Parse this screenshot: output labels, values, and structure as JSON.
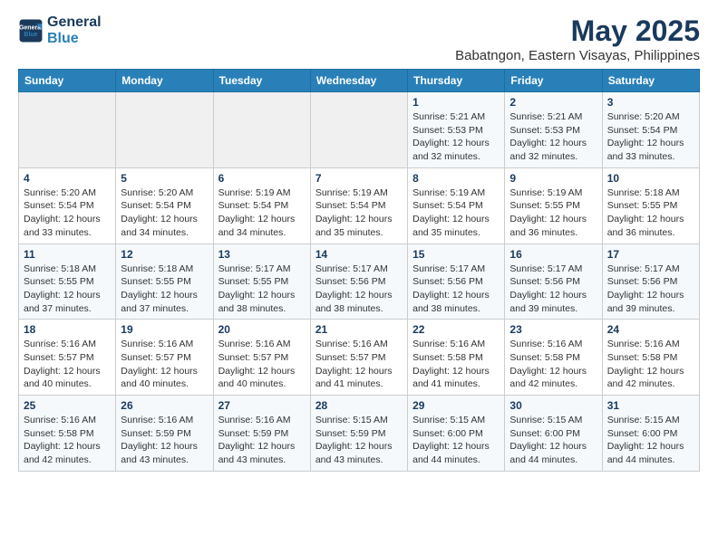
{
  "logo": {
    "line1": "General",
    "line2": "Blue"
  },
  "title": "May 2025",
  "subtitle": "Babatngon, Eastern Visayas, Philippines",
  "headers": [
    "Sunday",
    "Monday",
    "Tuesday",
    "Wednesday",
    "Thursday",
    "Friday",
    "Saturday"
  ],
  "weeks": [
    [
      {
        "day": "",
        "info": ""
      },
      {
        "day": "",
        "info": ""
      },
      {
        "day": "",
        "info": ""
      },
      {
        "day": "",
        "info": ""
      },
      {
        "day": "1",
        "info": "Sunrise: 5:21 AM\nSunset: 5:53 PM\nDaylight: 12 hours\nand 32 minutes."
      },
      {
        "day": "2",
        "info": "Sunrise: 5:21 AM\nSunset: 5:53 PM\nDaylight: 12 hours\nand 32 minutes."
      },
      {
        "day": "3",
        "info": "Sunrise: 5:20 AM\nSunset: 5:54 PM\nDaylight: 12 hours\nand 33 minutes."
      }
    ],
    [
      {
        "day": "4",
        "info": "Sunrise: 5:20 AM\nSunset: 5:54 PM\nDaylight: 12 hours\nand 33 minutes."
      },
      {
        "day": "5",
        "info": "Sunrise: 5:20 AM\nSunset: 5:54 PM\nDaylight: 12 hours\nand 34 minutes."
      },
      {
        "day": "6",
        "info": "Sunrise: 5:19 AM\nSunset: 5:54 PM\nDaylight: 12 hours\nand 34 minutes."
      },
      {
        "day": "7",
        "info": "Sunrise: 5:19 AM\nSunset: 5:54 PM\nDaylight: 12 hours\nand 35 minutes."
      },
      {
        "day": "8",
        "info": "Sunrise: 5:19 AM\nSunset: 5:54 PM\nDaylight: 12 hours\nand 35 minutes."
      },
      {
        "day": "9",
        "info": "Sunrise: 5:19 AM\nSunset: 5:55 PM\nDaylight: 12 hours\nand 36 minutes."
      },
      {
        "day": "10",
        "info": "Sunrise: 5:18 AM\nSunset: 5:55 PM\nDaylight: 12 hours\nand 36 minutes."
      }
    ],
    [
      {
        "day": "11",
        "info": "Sunrise: 5:18 AM\nSunset: 5:55 PM\nDaylight: 12 hours\nand 37 minutes."
      },
      {
        "day": "12",
        "info": "Sunrise: 5:18 AM\nSunset: 5:55 PM\nDaylight: 12 hours\nand 37 minutes."
      },
      {
        "day": "13",
        "info": "Sunrise: 5:17 AM\nSunset: 5:55 PM\nDaylight: 12 hours\nand 38 minutes."
      },
      {
        "day": "14",
        "info": "Sunrise: 5:17 AM\nSunset: 5:56 PM\nDaylight: 12 hours\nand 38 minutes."
      },
      {
        "day": "15",
        "info": "Sunrise: 5:17 AM\nSunset: 5:56 PM\nDaylight: 12 hours\nand 38 minutes."
      },
      {
        "day": "16",
        "info": "Sunrise: 5:17 AM\nSunset: 5:56 PM\nDaylight: 12 hours\nand 39 minutes."
      },
      {
        "day": "17",
        "info": "Sunrise: 5:17 AM\nSunset: 5:56 PM\nDaylight: 12 hours\nand 39 minutes."
      }
    ],
    [
      {
        "day": "18",
        "info": "Sunrise: 5:16 AM\nSunset: 5:57 PM\nDaylight: 12 hours\nand 40 minutes."
      },
      {
        "day": "19",
        "info": "Sunrise: 5:16 AM\nSunset: 5:57 PM\nDaylight: 12 hours\nand 40 minutes."
      },
      {
        "day": "20",
        "info": "Sunrise: 5:16 AM\nSunset: 5:57 PM\nDaylight: 12 hours\nand 40 minutes."
      },
      {
        "day": "21",
        "info": "Sunrise: 5:16 AM\nSunset: 5:57 PM\nDaylight: 12 hours\nand 41 minutes."
      },
      {
        "day": "22",
        "info": "Sunrise: 5:16 AM\nSunset: 5:58 PM\nDaylight: 12 hours\nand 41 minutes."
      },
      {
        "day": "23",
        "info": "Sunrise: 5:16 AM\nSunset: 5:58 PM\nDaylight: 12 hours\nand 42 minutes."
      },
      {
        "day": "24",
        "info": "Sunrise: 5:16 AM\nSunset: 5:58 PM\nDaylight: 12 hours\nand 42 minutes."
      }
    ],
    [
      {
        "day": "25",
        "info": "Sunrise: 5:16 AM\nSunset: 5:58 PM\nDaylight: 12 hours\nand 42 minutes."
      },
      {
        "day": "26",
        "info": "Sunrise: 5:16 AM\nSunset: 5:59 PM\nDaylight: 12 hours\nand 43 minutes."
      },
      {
        "day": "27",
        "info": "Sunrise: 5:16 AM\nSunset: 5:59 PM\nDaylight: 12 hours\nand 43 minutes."
      },
      {
        "day": "28",
        "info": "Sunrise: 5:15 AM\nSunset: 5:59 PM\nDaylight: 12 hours\nand 43 minutes."
      },
      {
        "day": "29",
        "info": "Sunrise: 5:15 AM\nSunset: 6:00 PM\nDaylight: 12 hours\nand 44 minutes."
      },
      {
        "day": "30",
        "info": "Sunrise: 5:15 AM\nSunset: 6:00 PM\nDaylight: 12 hours\nand 44 minutes."
      },
      {
        "day": "31",
        "info": "Sunrise: 5:15 AM\nSunset: 6:00 PM\nDaylight: 12 hours\nand 44 minutes."
      }
    ]
  ]
}
